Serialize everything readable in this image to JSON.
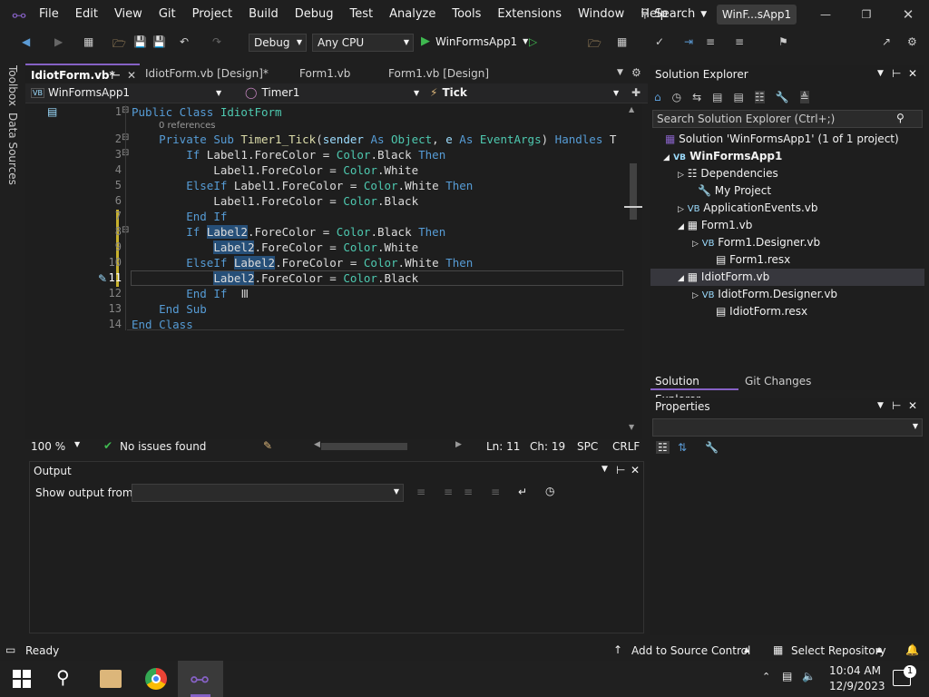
{
  "app": {
    "window_title": "WinF...sApp1",
    "menu": [
      "File",
      "Edit",
      "View",
      "Git",
      "Project",
      "Build",
      "Debug",
      "Test",
      "Analyze",
      "Tools",
      "Extensions",
      "Window",
      "Help"
    ],
    "search_label": "Search"
  },
  "toolbar": {
    "config": "Debug",
    "platform": "Any CPU",
    "start_label": "WinFormsApp1"
  },
  "side": {
    "toolbox": "Toolbox",
    "data_sources": "Data Sources"
  },
  "tabs": [
    {
      "label": "IdiotForm.vb*"
    },
    {
      "label": "IdiotForm.vb [Design]*"
    },
    {
      "label": "Form1.vb"
    },
    {
      "label": "Form1.vb [Design]"
    }
  ],
  "navbar": {
    "project": "WinFormsApp1",
    "member": "Timer1",
    "event": "Tick"
  },
  "editor": {
    "lines": [
      "1",
      "2",
      "3",
      "4",
      "5",
      "6",
      "7",
      "8",
      "9",
      "10",
      "11",
      "12",
      "13",
      "14"
    ],
    "code": [
      "Public Class IdiotForm",
      "Private Sub Timer1_Tick(sender As Object, e As EventArgs) Handles T",
      "If Label1.ForeColor = Color.Black Then",
      "Label1.ForeColor = Color.White",
      "ElseIf Label1.ForeColor = Color.White Then",
      "Label1.ForeColor = Color.Black",
      "End If",
      "If Label2.ForeColor = Color.Black Then",
      "Label2.ForeColor = Color.White",
      "ElseIf Label2.ForeColor = Color.White Then",
      "Label2.ForeColor = Color.Black",
      "End If",
      "End Sub",
      "End Class"
    ],
    "references": "0 references"
  },
  "editor_status": {
    "zoom": "100 %",
    "issues": "No issues found",
    "line": "Ln: 11",
    "col": "Ch: 19",
    "spc": "SPC",
    "eol": "CRLF"
  },
  "output": {
    "title": "Output",
    "show_from": "Show output from:"
  },
  "solution": {
    "title": "Solution Explorer",
    "search_placeholder": "Search Solution Explorer (Ctrl+;)",
    "items": [
      "Solution 'WinFormsApp1' (1 of 1 project)",
      "WinFormsApp1",
      "Dependencies",
      "My Project",
      "ApplicationEvents.vb",
      "Form1.vb",
      "Form1.Designer.vb",
      "Form1.resx",
      "IdiotForm.vb",
      "IdiotForm.Designer.vb",
      "IdiotForm.resx"
    ],
    "tab_solution": "Solution Explorer",
    "tab_git": "Git Changes"
  },
  "properties": {
    "title": "Properties"
  },
  "statusbar": {
    "ready": "Ready",
    "source_control": "Add to Source Control",
    "repo": "Select Repository"
  },
  "taskbar": {
    "time": "10:04 AM",
    "date": "12/9/2023",
    "notif": "1"
  },
  "colors": {
    "accent": "#007acc",
    "vs_purple": "#8661c5",
    "selection": "#264f78"
  }
}
